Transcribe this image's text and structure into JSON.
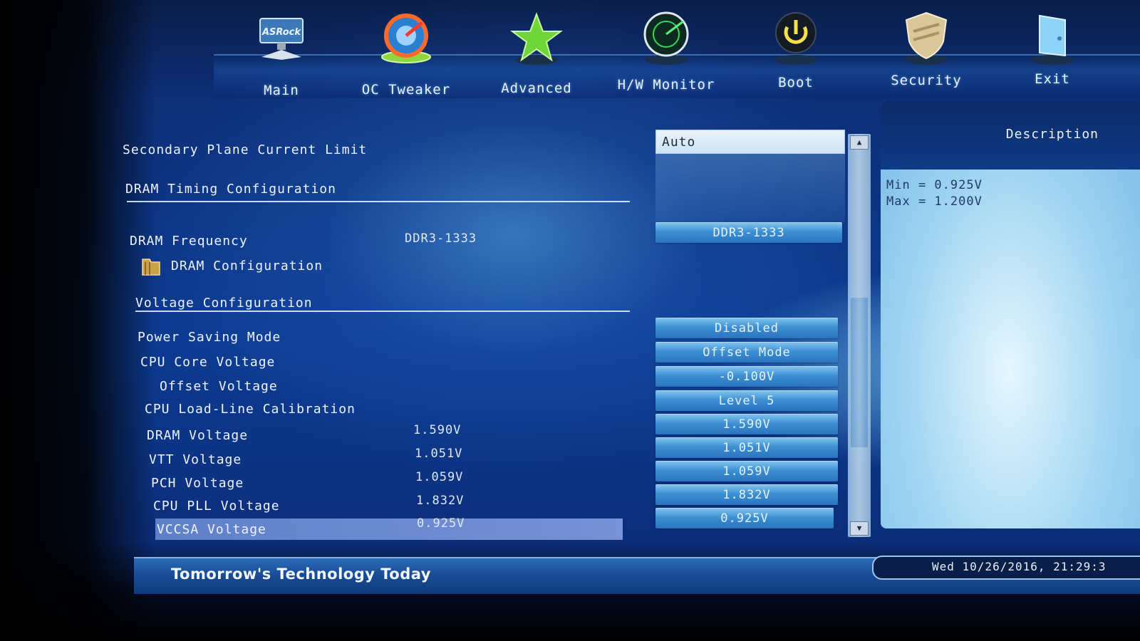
{
  "nav": {
    "items": [
      {
        "label": "Main",
        "icon": "asrock-monitor-icon"
      },
      {
        "label": "OC Tweaker",
        "icon": "speedometer-icon"
      },
      {
        "label": "Advanced",
        "icon": "star-icon"
      },
      {
        "label": "H/W Monitor",
        "icon": "radar-icon"
      },
      {
        "label": "Boot",
        "icon": "power-icon"
      },
      {
        "label": "Security",
        "icon": "shield-icon"
      },
      {
        "label": "Exit",
        "icon": "exit-door-icon"
      }
    ],
    "logo_text": "ASRock"
  },
  "settings": {
    "secondary_plane_current_limit": "Secondary Plane Current Limit",
    "dram_timing_section": "DRAM Timing Configuration",
    "dram_frequency": {
      "label": "DRAM Frequency",
      "current": "DDR3-1333",
      "value": "DDR3-1333"
    },
    "dram_configuration": "DRAM Configuration",
    "voltage_section": "Voltage Configuration",
    "power_saving_mode": {
      "label": "Power Saving Mode",
      "value": "Disabled"
    },
    "cpu_core_voltage": {
      "label": "CPU Core Voltage",
      "value": "Offset Mode"
    },
    "offset_voltage": {
      "label": "Offset Voltage",
      "value": "-0.100V"
    },
    "cpu_llc": {
      "label": "CPU Load-Line Calibration",
      "value": "Level 5"
    },
    "dram_voltage": {
      "label": "DRAM Voltage",
      "current": "1.590V",
      "value": "1.590V"
    },
    "vtt_voltage": {
      "label": "VTT Voltage",
      "current": "1.051V",
      "value": "1.051V"
    },
    "pch_voltage": {
      "label": "PCH Voltage",
      "current": "1.059V",
      "value": "1.059V"
    },
    "cpu_pll_voltage": {
      "label": "CPU PLL Voltage",
      "current": "1.832V",
      "value": "1.832V"
    },
    "vccsa_voltage": {
      "label": "VCCSA Voltage",
      "current": "0.925V",
      "value": "0.925V"
    }
  },
  "dropdown": {
    "selected": "Auto"
  },
  "description": {
    "title": "Description",
    "min": "Min = 0.925V",
    "max": "Max = 1.200V"
  },
  "footer": {
    "slogan": "Tomorrow's Technology Today",
    "datetime": "Wed 10/26/2016, 21:29:3"
  },
  "colors": {
    "accent": "#2a74bf",
    "highlight": "#7f9be0",
    "background": "#0d3b92"
  }
}
